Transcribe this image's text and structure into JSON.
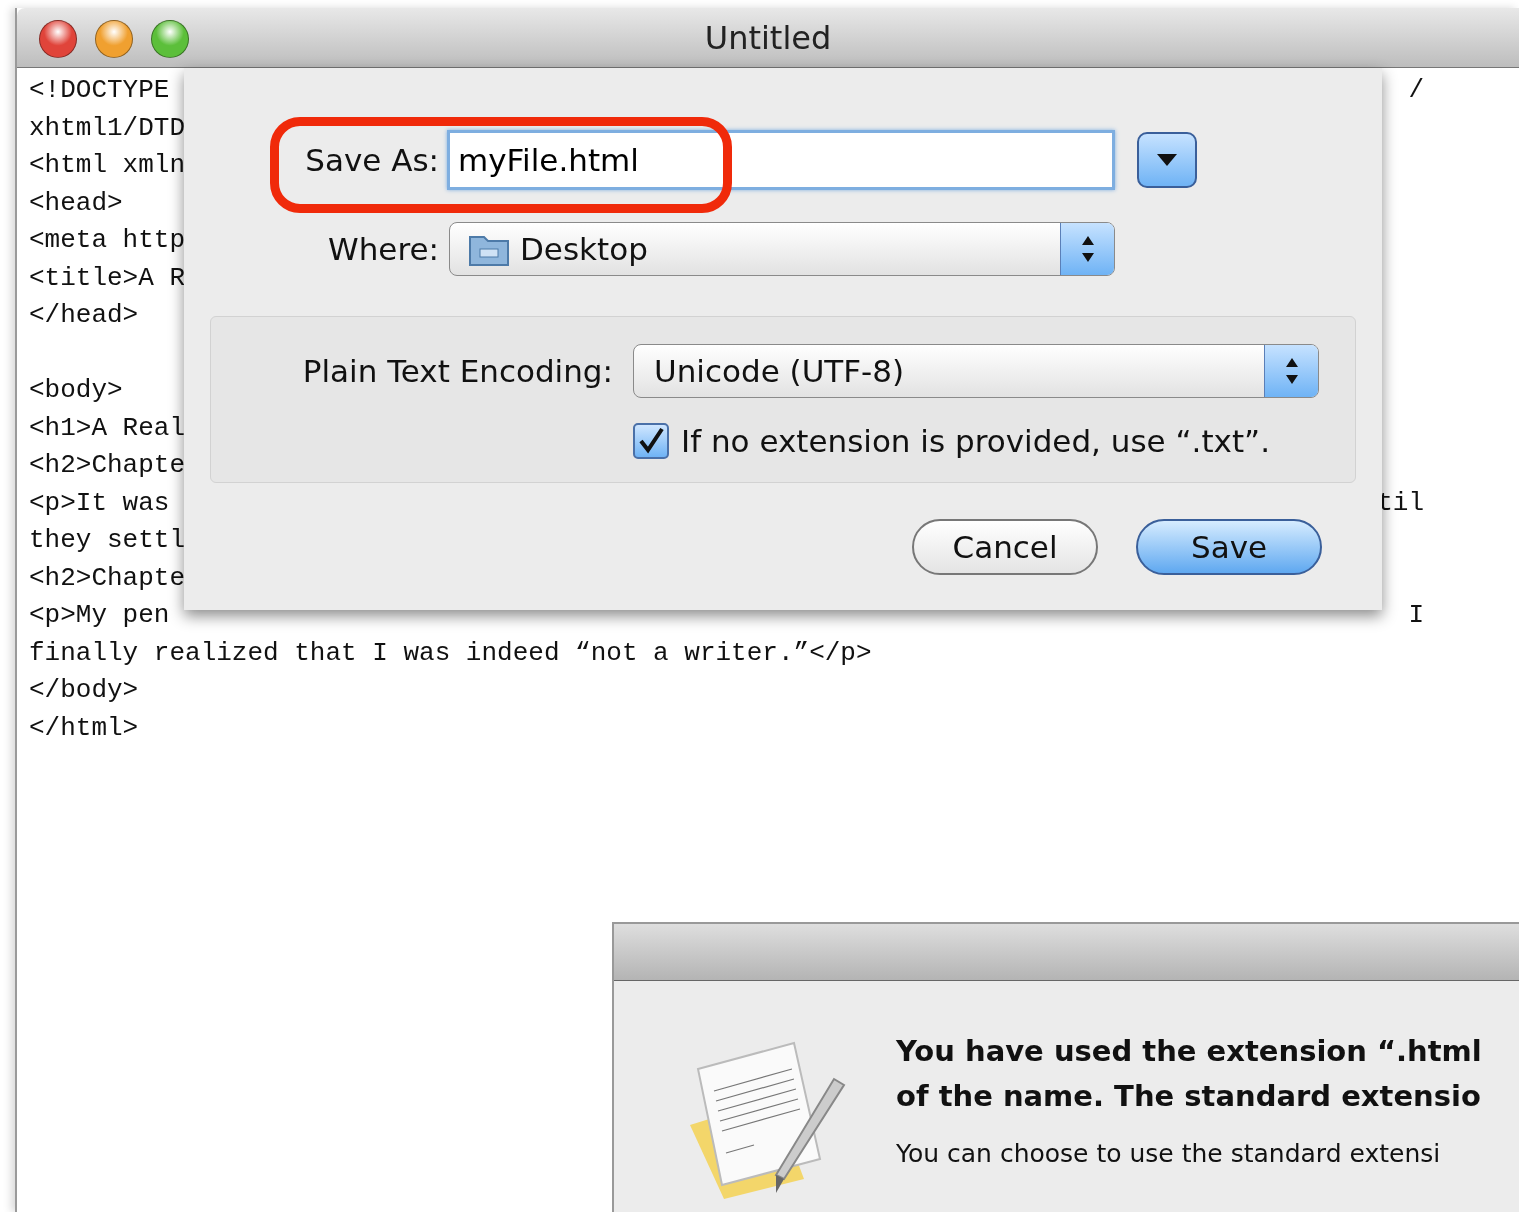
{
  "window": {
    "title": "Untitled"
  },
  "editor": {
    "lines": [
      {
        "kind": "code",
        "text": "<!DOCTYPE",
        "tail": "/"
      },
      {
        "kind": "code",
        "text": "xhtml1/DTD"
      },
      {
        "kind": "code",
        "text": "<html xmln"
      },
      {
        "kind": "code",
        "text": "<head>"
      },
      {
        "kind": "code",
        "text": "<meta http"
      },
      {
        "kind": "code",
        "text": "<title>A R"
      },
      {
        "kind": "code",
        "text": "</head>"
      },
      {
        "kind": "blank"
      },
      {
        "kind": "code",
        "text": "<body>"
      },
      {
        "kind": "code",
        "text": "<h1>A Real"
      },
      {
        "kind": "code",
        "text": "<h2>Chapte"
      },
      {
        "kind": "code",
        "text": "<p>It was",
        "tail": "til"
      },
      {
        "kind": "code",
        "text": "they settl"
      },
      {
        "kind": "code",
        "text": "<h2>Chapte"
      },
      {
        "kind": "code",
        "text": "<p>My pen",
        "tail": "I"
      },
      {
        "kind": "code",
        "text": "finally realized that I was indeed “not a writer.”</p>"
      },
      {
        "kind": "code",
        "text": "</body>"
      },
      {
        "kind": "code",
        "text": "</html>"
      }
    ]
  },
  "save_sheet": {
    "save_as": {
      "label": "Save As:",
      "value": "myFile.html",
      "highlighted": true
    },
    "expanded": false,
    "where": {
      "label": "Where:",
      "value": "Desktop"
    },
    "encoding": {
      "label": "Plain Text Encoding:",
      "value": "Unicode (UTF-8)"
    },
    "extension_option": {
      "label": "If no extension is provided, use “.txt”.",
      "checked": true
    },
    "buttons": [
      {
        "label": "Cancel",
        "default": false
      },
      {
        "label": "Save",
        "default": true
      }
    ]
  },
  "alert": {
    "message_lines": [
      "You have used the extension “.html",
      "of the name. The standard extensio"
    ],
    "info": "You can choose to use the standard extensi"
  }
}
